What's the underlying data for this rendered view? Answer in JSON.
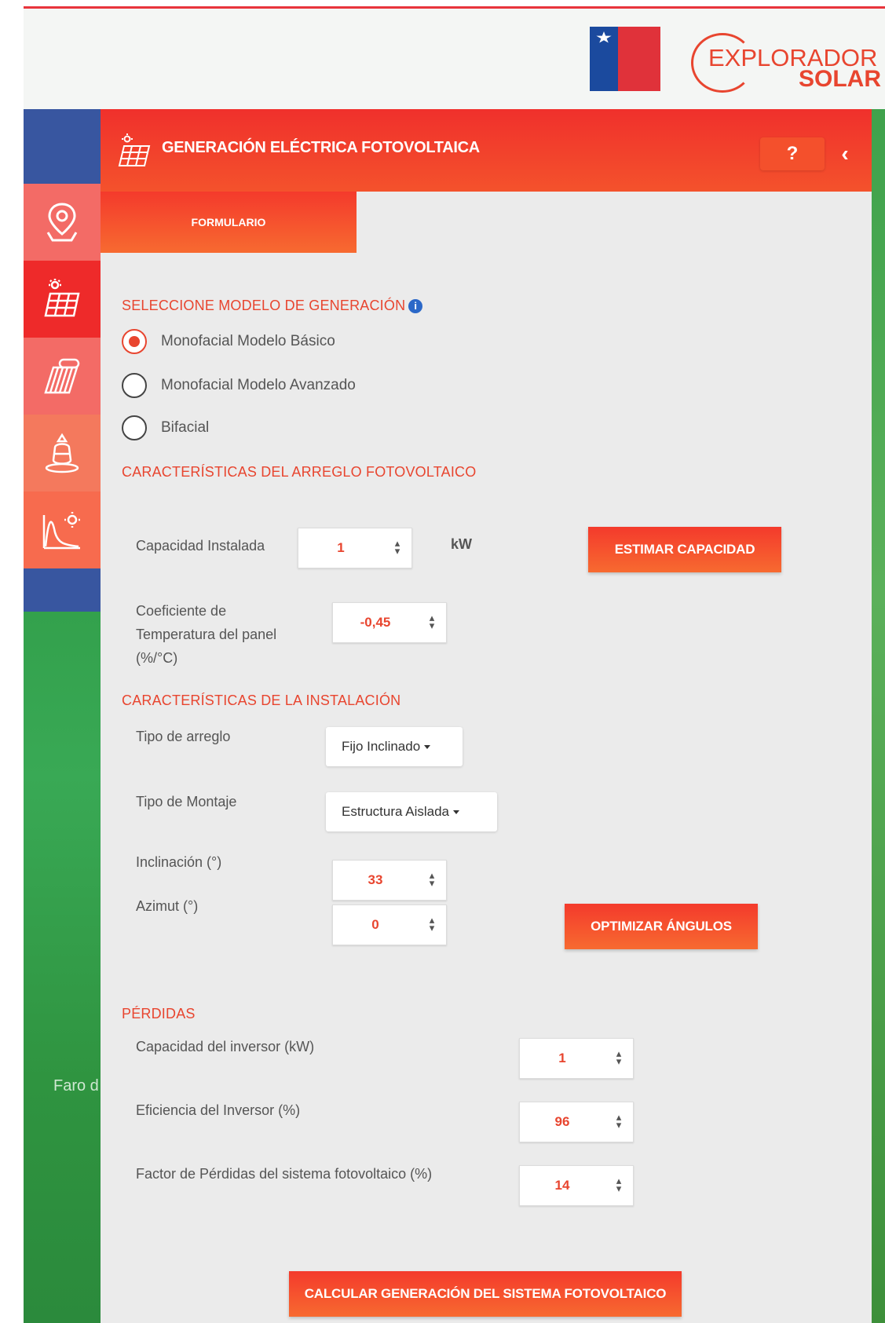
{
  "header": {
    "logo_line1": "EXPLORADOR",
    "logo_line2": "SOLAR"
  },
  "map": {
    "place_label": "Faro d"
  },
  "sidebar": {
    "items": [
      {
        "icon": "map-pin-icon"
      },
      {
        "icon": "solar-panel-icon"
      },
      {
        "icon": "solar-thermal-icon"
      },
      {
        "icon": "tank-icon"
      },
      {
        "icon": "chart-sun-icon"
      }
    ]
  },
  "panel": {
    "title": "GENERACIÓN ELÉCTRICA FOTOVOLTAICA",
    "help_label": "?",
    "back_label": "‹",
    "tab_label": "FORMULARIO"
  },
  "model": {
    "heading": "SELECCIONE MODELO DE GENERACIÓN",
    "info_glyph": "i",
    "options": [
      {
        "label": "Monofacial Modelo Básico",
        "selected": true
      },
      {
        "label": "Monofacial Modelo Avanzado",
        "selected": false
      },
      {
        "label": "Bifacial",
        "selected": false
      }
    ]
  },
  "array": {
    "heading": "CARACTERÍSTICAS DEL ARREGLO FOTOVOLTAICO",
    "capacity_label": "Capacidad Instalada",
    "capacity_value": "1",
    "capacity_unit": "kW",
    "estimate_button": "ESTIMAR CAPACIDAD",
    "temp_coef_label_line1": "Coeficiente de",
    "temp_coef_label_line2": "Temperatura del panel",
    "temp_coef_label_line3": "(%/°C)",
    "temp_coef_value": "-0,45"
  },
  "installation": {
    "heading": "CARACTERÍSTICAS DE LA INSTALACIÓN",
    "array_type_label": "Tipo de arreglo",
    "array_type_value": "Fijo Inclinado",
    "mount_type_label": "Tipo de Montaje",
    "mount_type_value": "Estructura Aislada",
    "tilt_label": "Inclinación (°)",
    "tilt_value": "33",
    "azimuth_label": "Azimut (°)",
    "azimuth_value": "0",
    "optimize_button": "OPTIMIZAR ÁNGULOS"
  },
  "losses": {
    "heading": "PÉRDIDAS",
    "inverter_capacity_label": "Capacidad del inversor (kW)",
    "inverter_capacity_value": "1",
    "inverter_efficiency_label": "Eficiencia del Inversor (%)",
    "inverter_efficiency_value": "96",
    "loss_factor_label": "Factor de Pérdidas del sistema fotovoltaico (%)",
    "loss_factor_value": "14"
  },
  "calculate_button": "CALCULAR GENERACIÓN DEL SISTEMA FOTOVOLTAICO",
  "colors": {
    "accent": "#e8452f",
    "header_red": "#f0302c",
    "panel_bg": "#ebebeb",
    "map_green": "#2e9a45"
  }
}
